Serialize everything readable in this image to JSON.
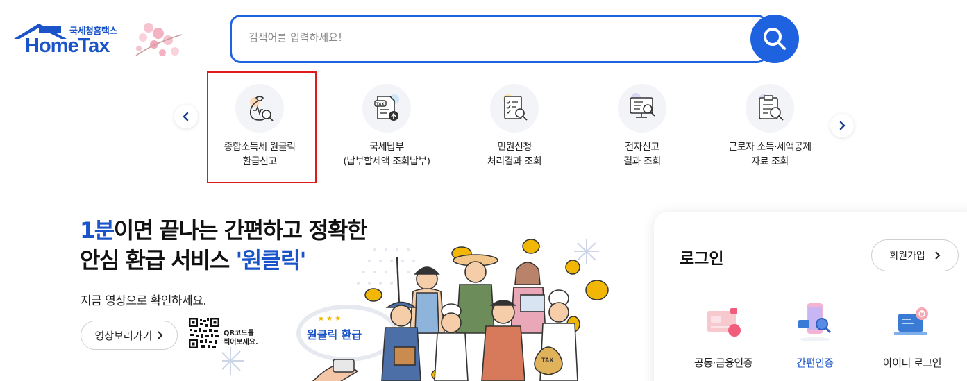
{
  "logo": {
    "sub_text": "국세청홈택스",
    "main_text": "HomeTax"
  },
  "search": {
    "placeholder": "검색어를 입력하세요!"
  },
  "quick_menu": {
    "items": [
      {
        "line1": "종합소득세 원클릭",
        "line2": "환급신고",
        "icon": "money-bag-search-icon"
      },
      {
        "line1": "국세납부",
        "line2": "(납부할세액 조회납부)",
        "icon": "tax-document-upload-icon"
      },
      {
        "line1": "민원신청",
        "line2": "처리결과 조회",
        "icon": "checklist-search-icon"
      },
      {
        "line1": "전자신고",
        "line2": "결과 조회",
        "icon": "monitor-search-icon"
      },
      {
        "line1": "근로자 소득·세액공제",
        "line2": "자료 조회",
        "icon": "clipboard-search-icon"
      }
    ]
  },
  "banner": {
    "title_hl": "1분",
    "title_rest1": "이면 끝나는 간편하고 정확한",
    "title_line2a": "안심 환급 서비스 ",
    "title_line2b": "'원클릭'",
    "subtitle": "지금 영상으로 확인하세요.",
    "video_button": "영상보러가기",
    "qr_line1": "QR코드를",
    "qr_line2": "찍어보세요.",
    "sign_text": "원클릭 환급",
    "bag_text": "TAX"
  },
  "login": {
    "title": "로그인",
    "join_button": "회원가입",
    "options": [
      {
        "label": "공동·금융인증",
        "icon": "certificate-card-icon"
      },
      {
        "label": "간편인증",
        "icon": "phone-search-icon"
      },
      {
        "label": "아이디 로그인",
        "icon": "laptop-power-icon"
      }
    ]
  },
  "colors": {
    "brand_blue": "#1f62e0",
    "highlight_red": "#e0191d",
    "title_blue": "#1a54c8"
  }
}
